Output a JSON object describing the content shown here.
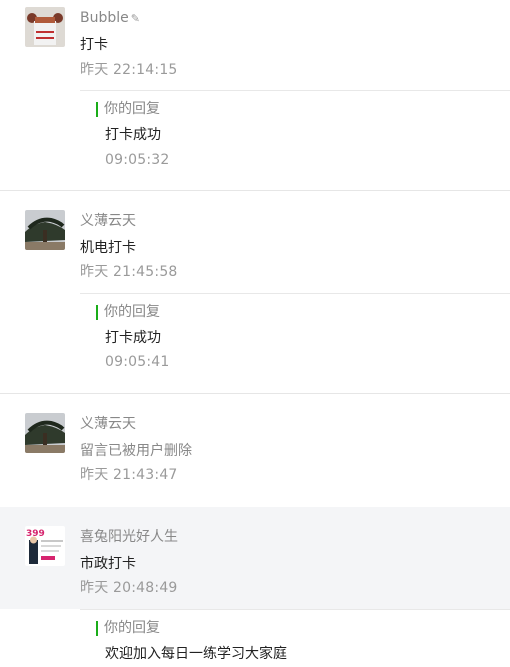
{
  "comments": [
    {
      "author": "Bubble",
      "author_badge": "verified-icon",
      "content": "打卡",
      "time": "昨天 22:14:15",
      "reply": {
        "label": "你的回复",
        "text": "打卡成功",
        "time": "09:05:32"
      }
    },
    {
      "author": "义薄云天",
      "content": "机电打卡",
      "time": "昨天 21:45:58",
      "reply": {
        "label": "你的回复",
        "text": "打卡成功",
        "time": "09:05:41"
      }
    },
    {
      "author": "义薄云天",
      "content": "留言已被用户删除",
      "time": "昨天 21:43:47"
    },
    {
      "author": "喜兔阳光好人生",
      "content": "市政打卡",
      "time": "昨天 20:48:49",
      "reply": {
        "label": "你的回复",
        "text": "欢迎加入每日一练学习大家庭"
      }
    }
  ],
  "colors": {
    "accent": "#1aad19",
    "highlight_bg": "#f4f5f7"
  }
}
